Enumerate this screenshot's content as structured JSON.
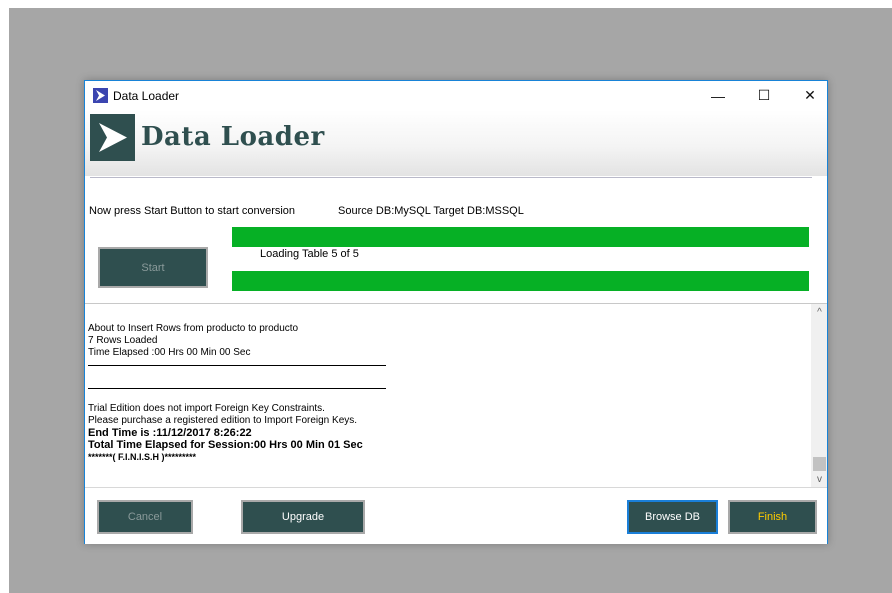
{
  "window": {
    "title": "Data Loader",
    "minimize_glyph": "—",
    "maximize_glyph": "☐",
    "close_glyph": "✕"
  },
  "banner": {
    "logo_text": "Data Loader",
    "logo_icon": "play-arrow-icon"
  },
  "status": {
    "instruction": "Now press Start Button to start conversion",
    "db_info": "Source DB:MySQL Target DB:MSSQL",
    "progress_label": "Loading Table 5 of 5",
    "progress_top": 1.0,
    "progress_bottom": 1.0
  },
  "buttons": {
    "start": "Start",
    "cancel": "Cancel",
    "upgrade": "Upgrade",
    "browse_db": "Browse DB",
    "finish": "Finish"
  },
  "log": {
    "lines_block1": [
      "About to Insert Rows from producto to producto",
      "7 Rows Loaded",
      "Time Elapsed :00 Hrs 00 Min 00 Sec"
    ],
    "lines_block2": [
      "Trial Edition does not import Foreign Key Constraints.",
      "Please purchase a registered edition to Import Foreign Keys."
    ],
    "bold_lines": [
      "End Time is :11/12/2017 8:26:22",
      "Total Time Elapsed for Session:00 Hrs 00 Min 01 Sec"
    ],
    "finish_line": "*******( F.I.N.I.S.H )*********"
  },
  "scrollbar": {
    "up_glyph": "^",
    "down_glyph": "v"
  },
  "colors": {
    "accent": "#2f4f4f",
    "progress": "#06b025",
    "finish_text": "#ffcc00",
    "window_border": "#1883d7"
  }
}
